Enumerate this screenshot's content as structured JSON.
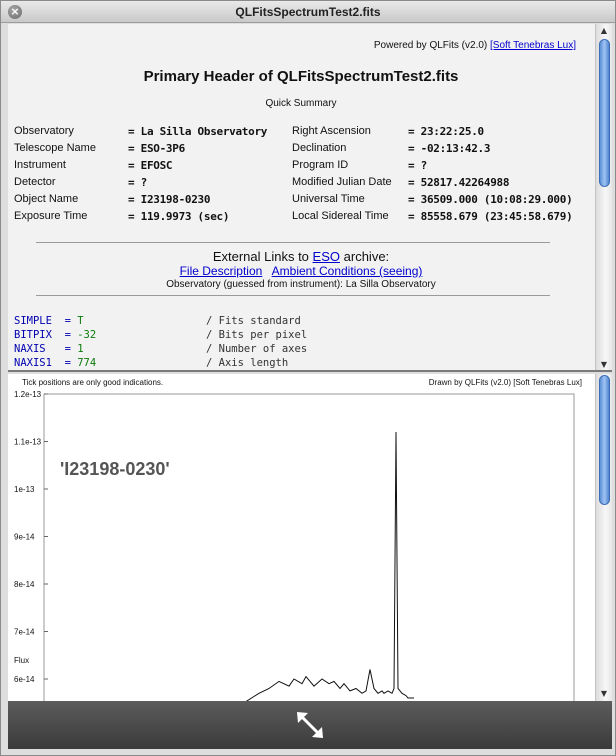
{
  "window": {
    "title": "QLFitsSpectrumTest2.fits"
  },
  "header": {
    "powered_by_prefix": "Powered by QLFits (v2.0)",
    "powered_by_link": "[Soft Tenebras Lux]",
    "title": "Primary Header of QLFitsSpectrumTest2.fits",
    "quick_summary": "Quick Summary",
    "left_fields": [
      {
        "label": "Observatory",
        "value": "= La Silla Observatory"
      },
      {
        "label": "Telescope Name",
        "value": "= ESO-3P6"
      },
      {
        "label": "Instrument",
        "value": "= EFOSC"
      },
      {
        "label": "Detector",
        "value": "= ?"
      },
      {
        "label": "Object Name",
        "value": "= I23198-0230"
      },
      {
        "label": "Exposure Time",
        "value": "= 119.9973 (sec)"
      }
    ],
    "right_fields": [
      {
        "label": "Right Ascension",
        "value": "= 23:22:25.0"
      },
      {
        "label": "Declination",
        "value": "= -02:13:42.3"
      },
      {
        "label": "Program ID",
        "value": "= ?"
      },
      {
        "label": "Modified Julian Date",
        "value": "= 52817.42264988"
      },
      {
        "label": "Universal Time",
        "value": "= 36509.000 (10:08:29.000)"
      },
      {
        "label": "Local Sidereal Time",
        "value": "= 85558.679 (23:45:58.679)"
      }
    ],
    "external_links_prefix": "External Links to",
    "eso_link": "ESO",
    "external_links_suffix": "archive:",
    "file_description_link": "File Description",
    "ambient_conditions_link": "Ambient Conditions (seeing)",
    "observatory_guess": "Observatory (guessed from instrument): La Silla Observatory",
    "fits_lines": [
      {
        "key": "SIMPLE  =",
        "value": " T",
        "comment": "/ Fits standard"
      },
      {
        "key": "BITPIX  =",
        "value": " -32",
        "comment": "/ Bits per pixel"
      },
      {
        "key": "NAXIS   =",
        "value": " 1",
        "comment": "/ Number of axes"
      },
      {
        "key": "NAXIS1  =",
        "value": " 774",
        "comment": "/ Axis length"
      }
    ]
  },
  "chart_notes": {
    "left": "Tick positions are only good indications.",
    "right": "Drawn by QLFits (v2.0) [Soft Tenebras Lux]"
  },
  "chart_data": {
    "type": "line",
    "title": "'I23198-0230'",
    "ylabel": "Flux",
    "xlabel": "",
    "ylim": [
      5.7e-14,
      1.2e-13
    ],
    "y_ticks": [
      "1.2e-13",
      "1.1e-13",
      "1e-13",
      "9e-14",
      "8e-14",
      "7e-14",
      "6e-14"
    ],
    "y_tick_values": [
      1.2e-13,
      1.1e-13,
      1e-13,
      9e-14,
      8e-14,
      7e-14,
      6e-14
    ],
    "grid": false,
    "series": [
      {
        "x": [
          0,
          200,
          215,
          225,
          235,
          245,
          250,
          258,
          262,
          270,
          278,
          285,
          290,
          296,
          300,
          306,
          312,
          318,
          322,
          326,
          330,
          334,
          338,
          340,
          344,
          348,
          350,
          352,
          354,
          358,
          362,
          364,
          366,
          370
        ],
        "y": [
          5.5e-14,
          5.5e-14,
          5.7e-14,
          5.8e-14,
          5.95e-14,
          5.85e-14,
          6e-14,
          5.9e-14,
          6.05e-14,
          5.85e-14,
          6e-14,
          5.9e-14,
          5.95e-14,
          5.8e-14,
          5.9e-14,
          5.75e-14,
          5.8e-14,
          5.7e-14,
          5.75e-14,
          6.2e-14,
          5.8e-14,
          5.7e-14,
          5.75e-14,
          5.7e-14,
          5.75e-14,
          5.7e-14,
          5.8e-14,
          1.12e-13,
          5.8e-14,
          5.7e-14,
          5.65e-14,
          5.6e-14,
          5.6e-14,
          5.6e-14
        ]
      }
    ]
  },
  "colors": {
    "scroll_thumb": "#6a9be0",
    "link": "#0000cc",
    "fits_key": "#0000b0",
    "fits_value": "#0a7a0a"
  },
  "icons": {
    "close": "close-icon",
    "resize": "resize-arrows-icon"
  }
}
